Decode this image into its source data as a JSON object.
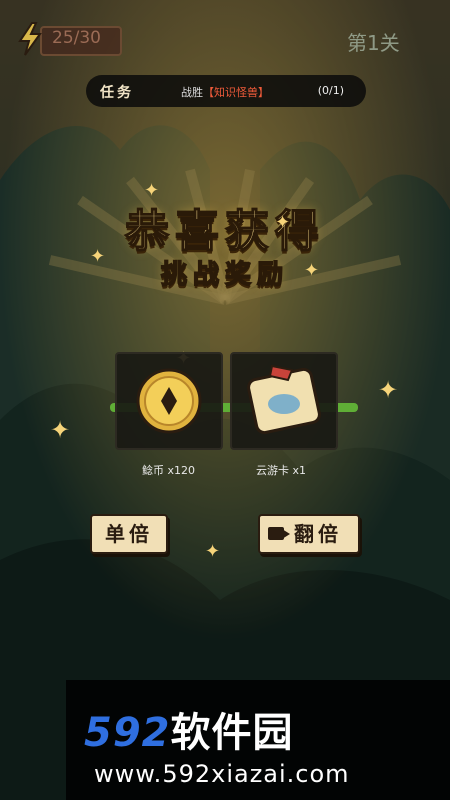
{
  "hud": {
    "energy": "25/30",
    "level": "第1关"
  },
  "quest": {
    "title": "任务",
    "desc_prefix": "战胜",
    "desc_target": "【知识怪兽】",
    "progress": "(0/1)"
  },
  "reward_popup": {
    "title": "恭喜获得",
    "subtitle": "挑战奖励",
    "items": [
      {
        "name": "鲶币 x120",
        "icon": "coin-icon"
      },
      {
        "name": "云游卡 x1",
        "icon": "scroll-icon"
      }
    ],
    "buttons": {
      "single": "单倍",
      "double": "翻倍"
    }
  },
  "watermark": {
    "brand_num": "592",
    "brand_cn": "软件园",
    "url": "www.592xiazai.com"
  },
  "colors": {
    "gold": "#f6d98a",
    "quest_highlight": "#f05b3a",
    "progress_green": "#5fae36",
    "button_paper": "#f1dfb6"
  }
}
